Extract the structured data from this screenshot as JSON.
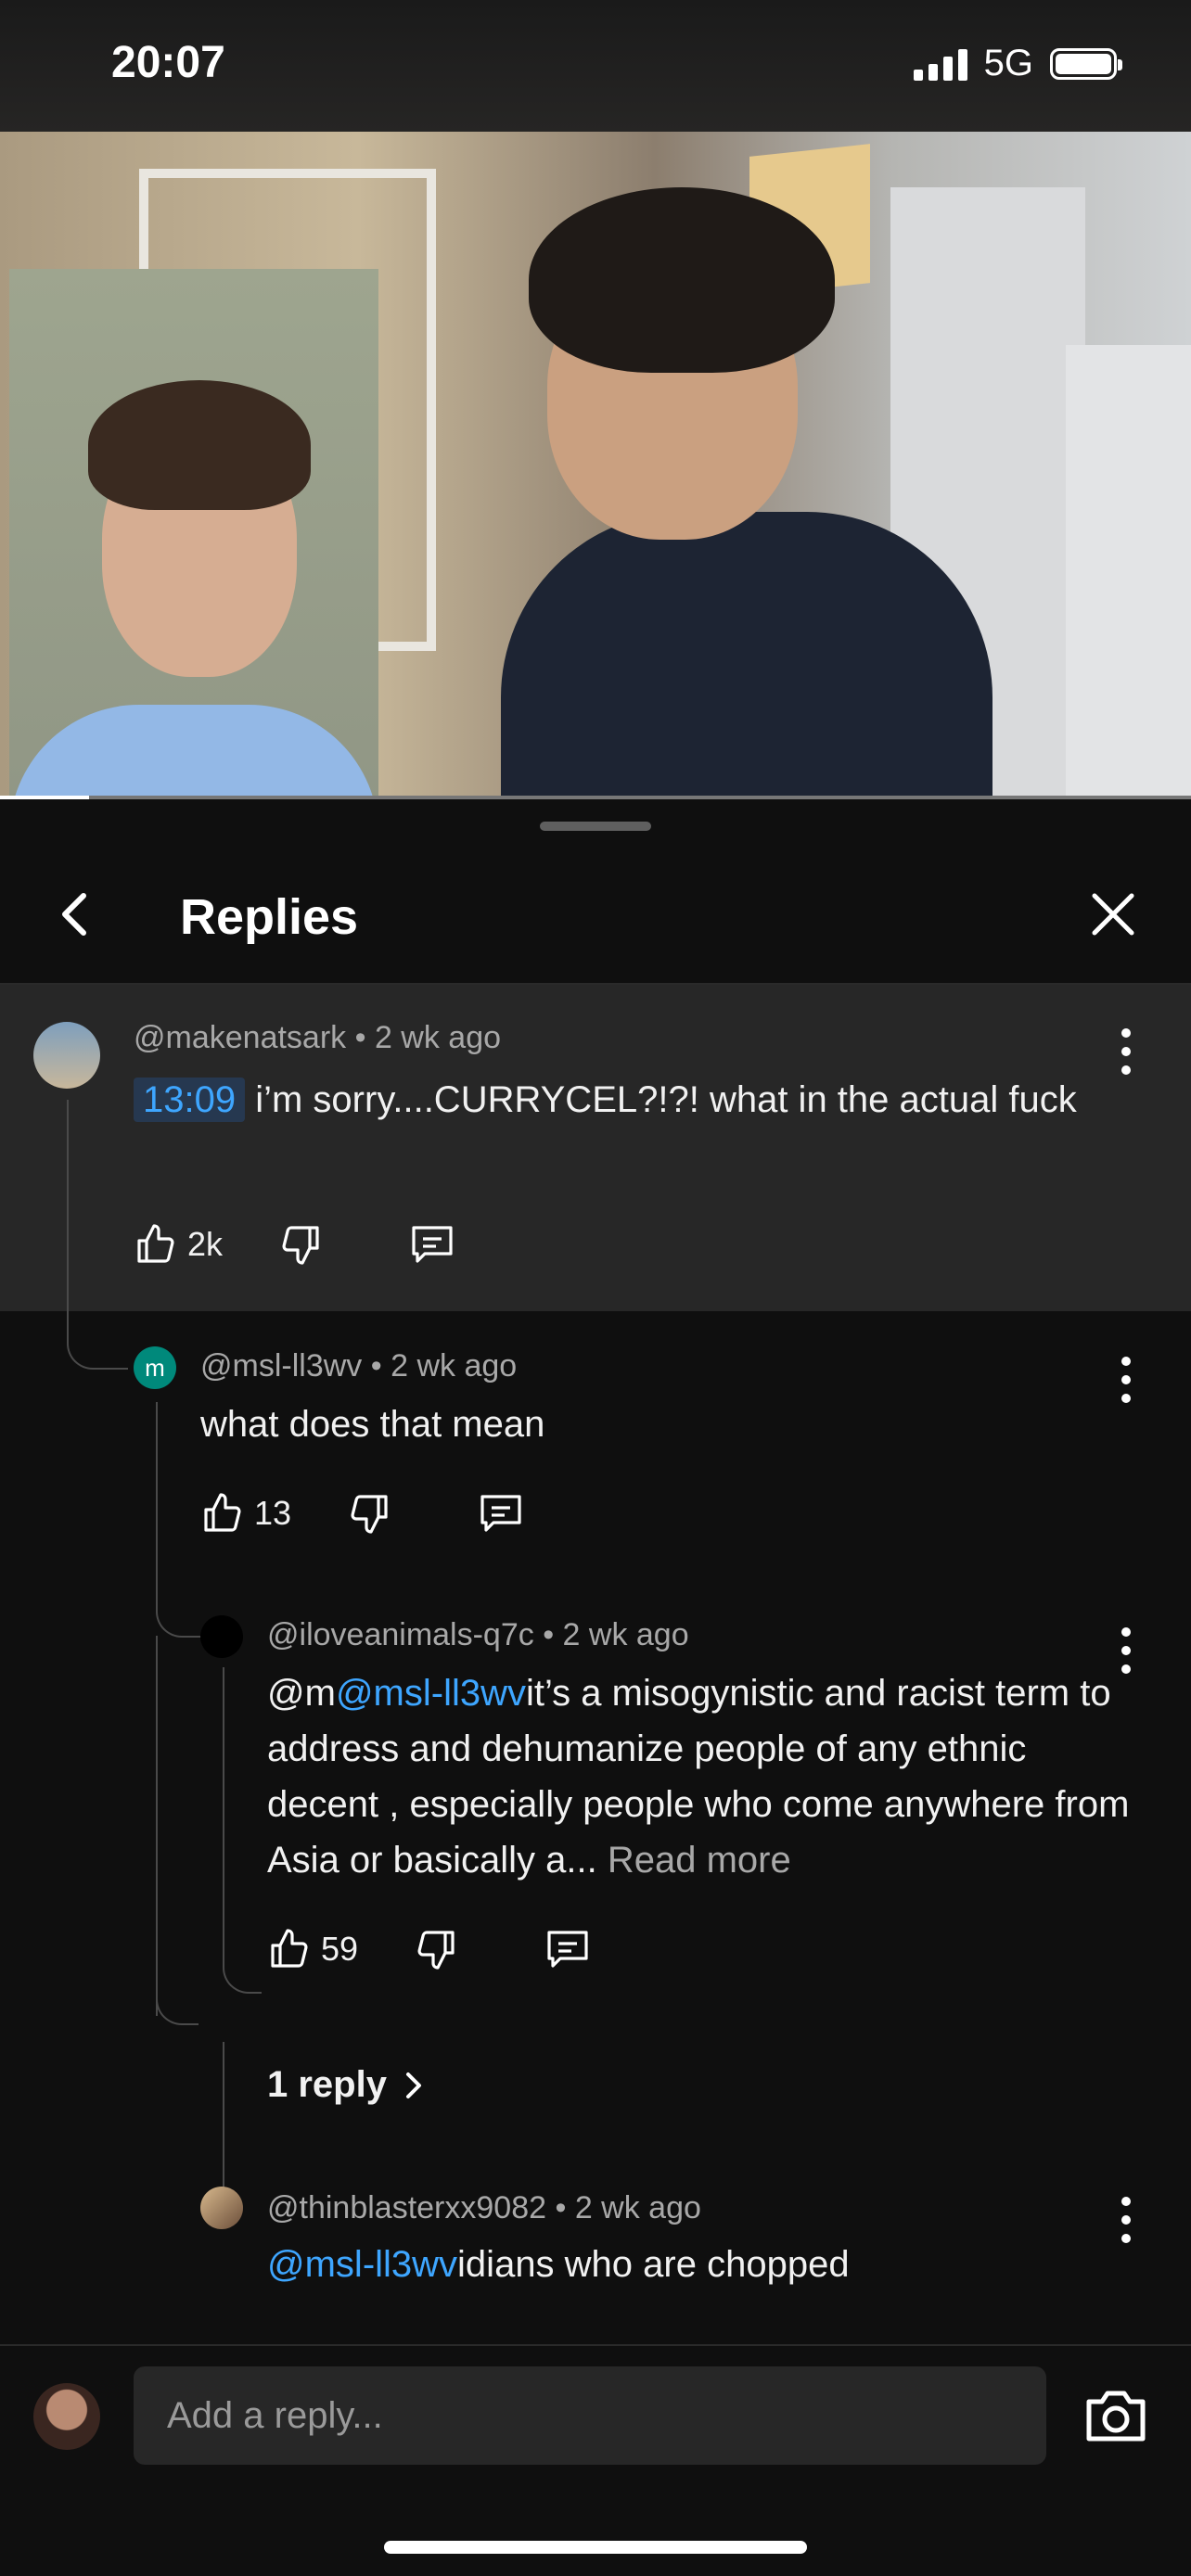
{
  "status": {
    "time": "20:07",
    "network": "5G"
  },
  "video": {
    "progress_fraction": 0.075
  },
  "sheet": {
    "title": "Replies",
    "back_icon": "chevron-left-icon",
    "close_icon": "close-icon"
  },
  "parent_comment": {
    "author": "@makenatsark",
    "age": "2 wk ago",
    "timestamp_link": "13:09",
    "text": " i’m sorry....CURRYCEL?!?! what in the actual fuck",
    "likes": "2k"
  },
  "replies": [
    {
      "author": "@msl-ll3wv",
      "avatar_letter": "m",
      "age": "2 wk ago",
      "text": "what does that mean",
      "likes": "13"
    },
    {
      "author": "@iloveanimals-q7c",
      "age": "2 wk ago",
      "prefix": "@m",
      "mention": "@msl-ll3wv",
      "text": "it’s a misogynistic and racist term to address and dehumanize people of any ethnic decent , especially people who come anywhere from Asia or basically a... ",
      "read_more": "Read more",
      "likes": "59",
      "replies_link": "1 reply"
    },
    {
      "author": "@thinblasterxx9082",
      "age": "2 wk ago",
      "mention": "@msl-ll3wv",
      "text": "idians who are chopped"
    }
  ],
  "composer": {
    "placeholder": "Add a reply..."
  },
  "colors": {
    "accent_blue": "#3ea6ff",
    "sheet_bg": "#0f0f0f",
    "highlight_bg": "#272727",
    "avatar_green": "#00897b"
  }
}
